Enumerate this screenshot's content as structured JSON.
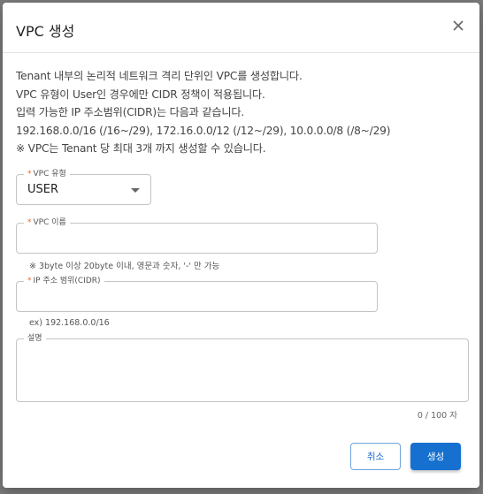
{
  "dialog": {
    "title": "VPC 생성",
    "close_icon": "close-icon",
    "description": [
      "Tenant 내부의 논리적 네트워크 격리 단위인 VPC를 생성합니다.",
      "VPC 유형이 User인 경우에만 CIDR 정책이 적용됩니다.",
      "입력 가능한 IP 주소범위(CIDR)는 다음과 같습니다.",
      "192.168.0.0/16 (/16~/29), 172.16.0.0/12 (/12~/29), 10.0.0.0/8 (/8~/29)",
      "※ VPC는 Tenant 당 최대 3개 까지 생성할 수 있습니다."
    ],
    "fields": {
      "vpc_type": {
        "label": "VPC 유형",
        "required": "*",
        "value": "USER",
        "options": [
          "USER"
        ]
      },
      "vpc_name": {
        "label": "VPC 이름",
        "required": "*",
        "value": "",
        "hint": "※ 3byte 이상 20byte 이내, 영문과 숫자, '-' 만 가능"
      },
      "cidr": {
        "label": "IP 주소 범위(CIDR)",
        "required": "*",
        "value": "",
        "hint": "ex) 192.168.0.0/16"
      },
      "description": {
        "label": "설명",
        "value": "",
        "counter": "0 / 100 자"
      }
    },
    "buttons": {
      "cancel": "취소",
      "create": "생성"
    },
    "colors": {
      "primary": "#1670d0",
      "required": "#f26522"
    }
  }
}
